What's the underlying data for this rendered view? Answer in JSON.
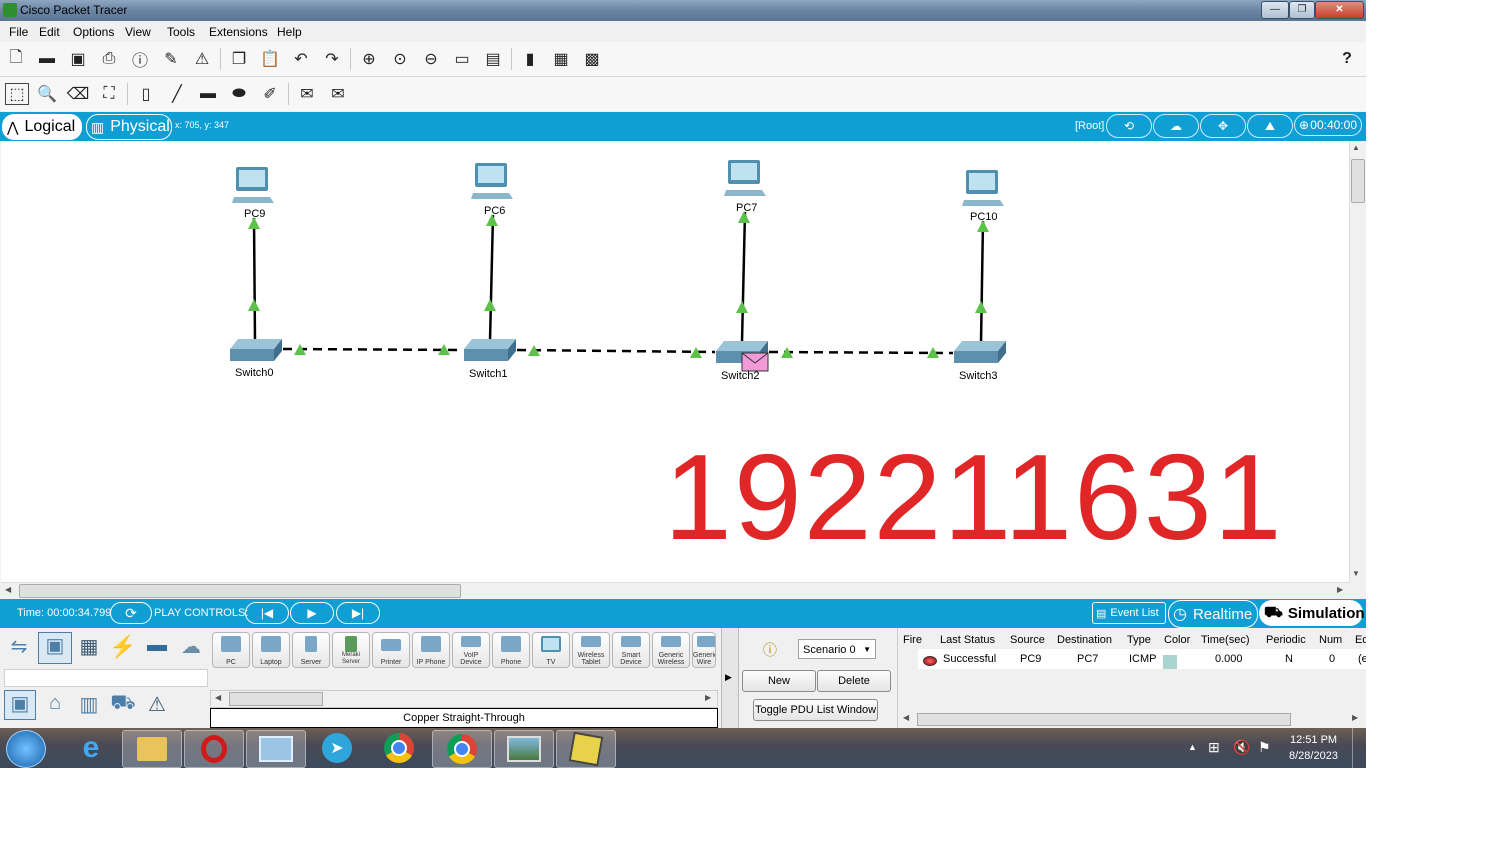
{
  "window": {
    "title": "Cisco Packet Tracer",
    "controls": {
      "minimize": "—",
      "maximize": "❐",
      "close": "✕"
    }
  },
  "menu": [
    "File",
    "Edit",
    "Options",
    "View",
    "Tools",
    "Extensions",
    "Help"
  ],
  "toolbar": {
    "main_icons": [
      "new-icon",
      "open-icon",
      "save-icon",
      "print-icon",
      "info-icon",
      "network-wizard-icon",
      "antenna-icon",
      "copy-icon",
      "paste-icon",
      "undo-icon",
      "redo-icon",
      "zoom-in-icon",
      "zoom-reset-icon",
      "zoom-out-icon",
      "drawing-palette-icon",
      "custom-device-icon",
      "pdu-list-icon",
      "device-template-icon",
      "ipc-icon"
    ],
    "help_label": "?",
    "edit_icons": [
      "select-icon",
      "inspect-icon",
      "delete-icon",
      "resize-icon",
      "place-note-icon",
      "draw-line-icon",
      "draw-rectangle-icon",
      "draw-ellipse-icon",
      "freeform-icon",
      "add-simple-pdu-icon",
      "add-complex-pdu-icon"
    ]
  },
  "view_bar": {
    "logical_label": "Logical",
    "physical_label": "Physical",
    "coords": "x: 705, y: 347",
    "root_label": "[Root]",
    "time": "00:40:00"
  },
  "topology": {
    "pcs": [
      {
        "name": "PC9"
      },
      {
        "name": "PC6"
      },
      {
        "name": "PC7"
      },
      {
        "name": "PC10"
      }
    ],
    "switches": [
      {
        "name": "Switch0"
      },
      {
        "name": "Switch1"
      },
      {
        "name": "Switch2"
      },
      {
        "name": "Switch3"
      }
    ],
    "watermark": "192211631"
  },
  "sim_bar": {
    "time_label": "Time: 00:00:34.799",
    "play_controls_label": "PLAY CONTROLS:",
    "event_list_label": "Event List",
    "realtime_label": "Realtime",
    "simulation_label": "Simulation"
  },
  "device_panel": {
    "categories": [
      "network-devices-icon",
      "end-devices-icon",
      "components-icon",
      "connections-icon",
      "miscellaneous-icon",
      "multiuser-icon"
    ],
    "subcategories": [
      "end-devices-sub-icon",
      "home-icon",
      "smart-city-icon",
      "industrial-icon",
      "power-grid-icon"
    ],
    "devices": [
      "PC",
      "Laptop",
      "Server",
      "Meraki Server",
      "Printer",
      "IP Phone",
      "VoIP Device",
      "Phone",
      "TV",
      "Wireless Tablet",
      "Smart Device",
      "Generic Wireless",
      "Generic Wire"
    ],
    "status_label": "Copper Straight-Through"
  },
  "scenario": {
    "value": "Scenario 0",
    "new_label": "New",
    "delete_label": "Delete",
    "toggle_label": "Toggle PDU List Window"
  },
  "pdu_table": {
    "headers": [
      "Fire",
      "Last Status",
      "Source",
      "Destination",
      "Type",
      "Color",
      "Time(sec)",
      "Periodic",
      "Num",
      "Ed"
    ],
    "rows": [
      {
        "last_status": "Successful",
        "source": "PC9",
        "destination": "PC7",
        "type": "ICMP",
        "color": "#a9d4d0",
        "time": "0.000",
        "periodic": "N",
        "num": "0",
        "edit": "(e"
      }
    ]
  },
  "taskbar": {
    "apps": [
      "windows-start-icon",
      "internet-explorer-icon",
      "file-explorer-icon",
      "opera-icon",
      "remote-desktop-icon",
      "telegram-icon",
      "chrome-icon",
      "chrome-profile-icon",
      "photos-icon",
      "packet-tracer-icon"
    ],
    "clock_time": "12:51 PM",
    "clock_date": "8/28/2023"
  }
}
